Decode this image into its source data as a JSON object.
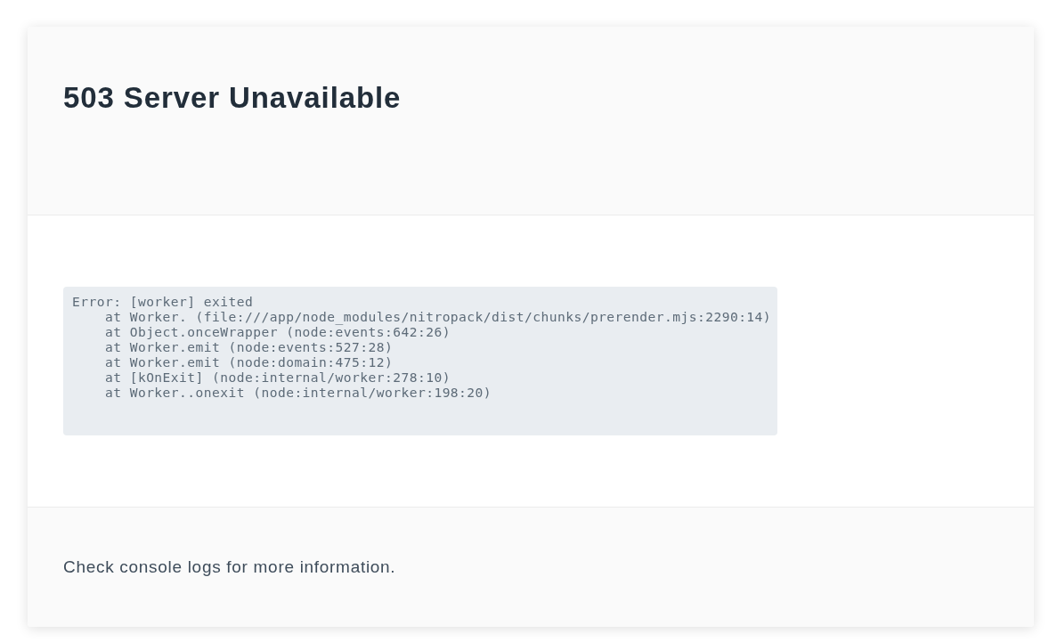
{
  "header": {
    "title": "503 Server Unavailable"
  },
  "body": {
    "stack_trace": "Error: [worker] exited\n    at Worker. (file:///app/node_modules/nitropack/dist/chunks/prerender.mjs:2290:14)\n    at Object.onceWrapper (node:events:642:26)\n    at Worker.emit (node:events:527:28)\n    at Worker.emit (node:domain:475:12)\n    at [kOnExit] (node:internal/worker:278:10)\n    at Worker..onexit (node:internal/worker:198:20)"
  },
  "footer": {
    "message": "Check console logs for more information."
  }
}
